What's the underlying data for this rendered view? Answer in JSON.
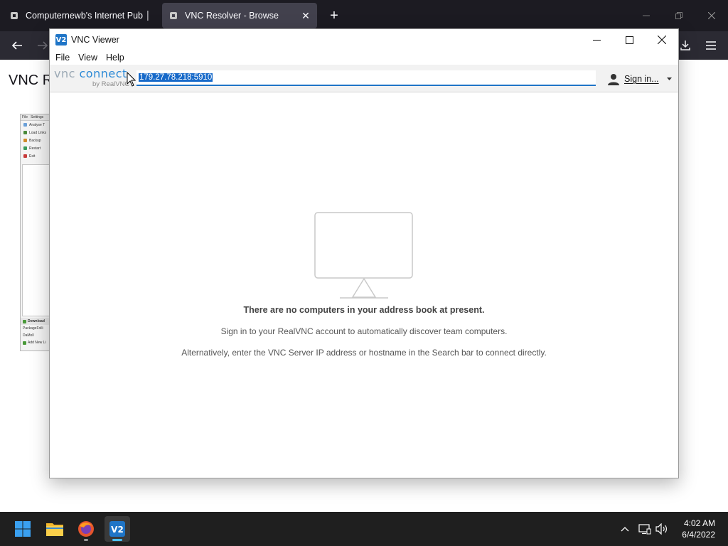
{
  "browser": {
    "tabs": [
      {
        "title": "Computernewb's Internet Pub │"
      },
      {
        "title": "VNC Resolver - Browse"
      }
    ],
    "page_heading": "VNC R"
  },
  "vnc": {
    "title": "VNC Viewer",
    "menu": [
      "File",
      "View",
      "Help"
    ],
    "logo": {
      "vnc": "vnc",
      "connect": "connect",
      "by": "by RealVNC"
    },
    "search_value": "179.27.78.218:5910",
    "signin_label": "Sign in...",
    "empty_heading": "There are no computers in your address book at present.",
    "empty_line1": "Sign in to your RealVNC account to automatically discover team computers.",
    "empty_line2": "Alternatively, enter the VNC Server IP address or hostname in the Search bar to connect directly."
  },
  "thumbnail": {
    "menu": [
      "File",
      "Settings"
    ],
    "items": [
      "Analyse T",
      "Load Links",
      "Backup",
      "Restart",
      "Exit"
    ],
    "footer": [
      "Download",
      "PackageFolli",
      "DaMoll",
      "Add New Li"
    ]
  },
  "taskbar": {
    "time": "4:02 AM",
    "date": "6/4/2022"
  },
  "colors": {
    "accent": "#1f75c7",
    "taskbar": "#1f1f1f",
    "browser_tabbar": "#1c1b22"
  }
}
